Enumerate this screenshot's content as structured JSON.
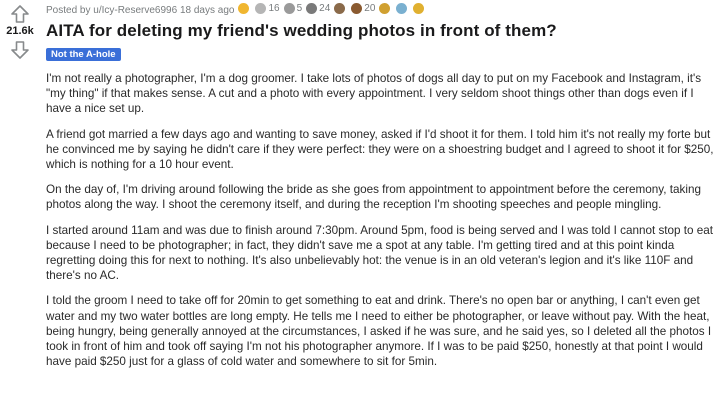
{
  "post": {
    "score": "21.6k",
    "meta_text": "Posted by u/Icy-Reserve6996 18 days ago",
    "awards": [
      {
        "icon": "gold-award",
        "color": "#f0b630",
        "count": ""
      },
      {
        "icon": "silver-award",
        "color": "#b5b5b5",
        "count": "16"
      },
      {
        "icon": "wholesome-award",
        "color": "#9a9a9a",
        "count": "5"
      },
      {
        "icon": "helpful-award",
        "color": "#7a7a7a",
        "count": "24"
      },
      {
        "icon": "platinum-award",
        "color": "#8a6a4a",
        "count": ""
      },
      {
        "icon": "fire-award",
        "color": "#8a5a30",
        "count": "20"
      },
      {
        "icon": "hug-award",
        "color": "#d0a030",
        "count": ""
      },
      {
        "icon": "heart-award",
        "color": "#7ab0d0",
        "count": ""
      },
      {
        "icon": "star-award",
        "color": "#e0b030",
        "count": ""
      }
    ],
    "title": "AITA for deleting my friend's wedding photos in front of them?",
    "flair": "Not the A-hole",
    "flair_color": "#3a6fd8",
    "paragraphs": [
      "I'm not really a photographer, I'm a dog groomer. I take lots of photos of dogs all day to put on my Facebook and Instagram, it's \"my thing\" if that makes sense. A cut and a photo with every appointment. I very seldom shoot things other than dogs even if I have a nice set up.",
      "A friend got married a few days ago and wanting to save money, asked if I'd shoot it for them. I told him it's not really my forte but he convinced me by saying he didn't care if they were perfect: they were on a shoestring budget and I agreed to shoot it for $250, which is nothing for a 10 hour event.",
      "On the day of, I'm driving around following the bride as she goes from appointment to appointment before the ceremony, taking photos along the way. I shoot the ceremony itself, and during the reception I'm shooting speeches and people mingling.",
      "I started around 11am and was due to finish around 7:30pm. Around 5pm, food is being served and I was told I cannot stop to eat because I need to be photographer; in fact, they didn't save me a spot at any table. I'm getting tired and at this point kinda regretting doing this for next to nothing. It's also unbelievably hot: the venue is in an old veteran's legion and it's like 110F and there's no AC.",
      "I told the groom I need to take off for 20min to get something to eat and drink. There's no open bar or anything, I can't even get water and my two water bottles are long empty. He tells me I need to either be photographer, or leave without pay. With the heat, being hungry, being generally annoyed at the circumstances, I asked if he was sure, and he said yes, so I deleted all the photos I took in front of him and took off saying I'm not his photographer anymore. If I was to be paid $250, honestly at that point I would have paid $250 just for a glass of cold water and somewhere to sit for 5min."
    ]
  }
}
